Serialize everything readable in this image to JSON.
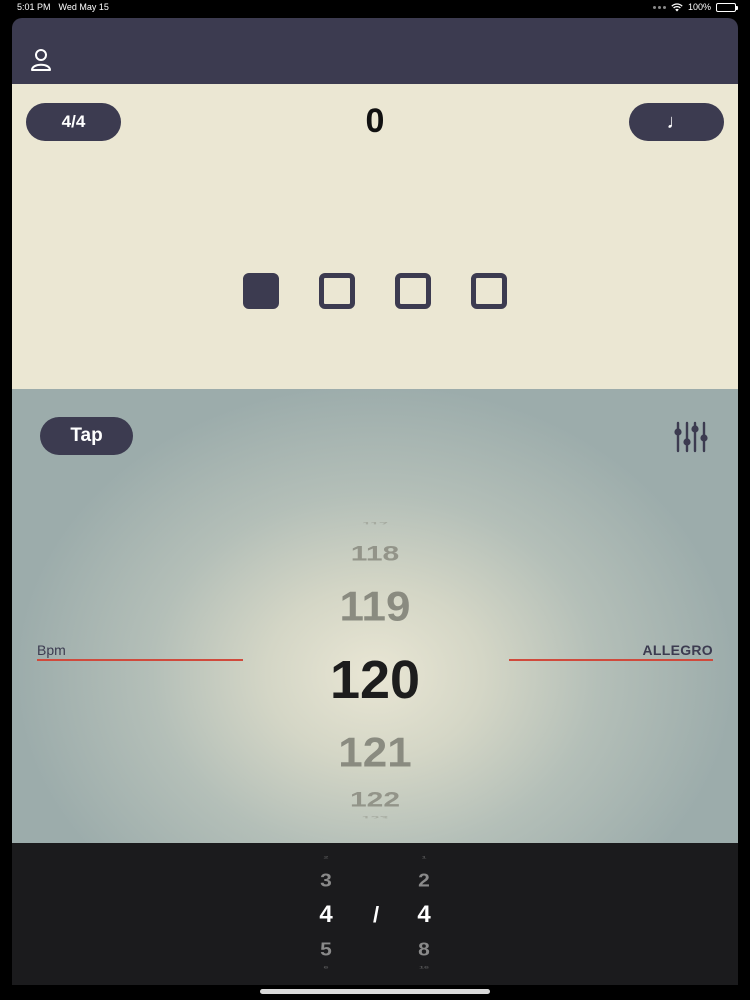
{
  "status_bar": {
    "time": "5:01 PM",
    "date": "Wed May 15",
    "battery": "100%",
    "battery_level": 1.0
  },
  "header": {
    "profile_icon": "person-icon"
  },
  "beat_panel": {
    "time_signature_button": "4/4",
    "beat_count": "0",
    "note_button_icon": "♩",
    "beats": [
      true,
      false,
      false,
      false
    ]
  },
  "tempo_panel": {
    "tap_label": "Tap",
    "settings_icon": "sliders-icon",
    "bpm_label": "Bpm",
    "tempo_marking": "ALLEGRO",
    "bpm_wheel": [
      "117",
      "118",
      "119",
      "120",
      "121",
      "122",
      "123"
    ],
    "bpm_selected": "120"
  },
  "time_signature_picker": {
    "numerator": [
      "2",
      "3",
      "4",
      "5",
      "6"
    ],
    "numerator_selected": "4",
    "separator": "/",
    "denominator": [
      "1",
      "2",
      "4",
      "8",
      "16"
    ],
    "denominator_selected": "4"
  },
  "colors": {
    "accent_dark": "#3c3b50",
    "cream": "#ebe7d3",
    "red_line": "#d04a3c",
    "bottom": "#1b1b1d"
  }
}
